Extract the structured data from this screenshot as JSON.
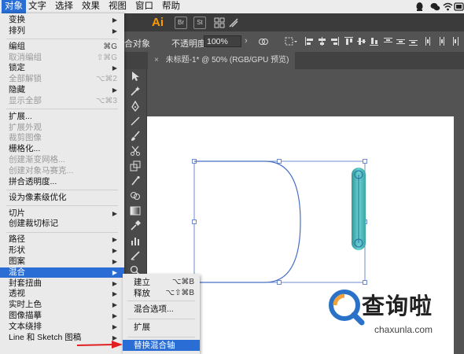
{
  "menubar": {
    "items": [
      "对象",
      "文字",
      "选择",
      "效果",
      "视图",
      "窗口",
      "帮助"
    ],
    "active_index": 0,
    "tray_icons": [
      "qq-icon",
      "wechat-icon",
      "wifi-icon",
      "battery-icon",
      "app-icon"
    ]
  },
  "appbar": {
    "app_label": "Ai"
  },
  "control_bar": {
    "partial_label": "合对象",
    "opacity_label": "不透明度:",
    "opacity_value": "100%"
  },
  "document_tab": {
    "label": "未标题-1* @ 50% (RGB/GPU 预览)"
  },
  "main_menu": {
    "items": [
      {
        "label": "变换",
        "shortcut": "",
        "submenu": true,
        "disabled": false,
        "sep_after": false
      },
      {
        "label": "排列",
        "shortcut": "",
        "submenu": true,
        "disabled": false,
        "sep_after": true
      },
      {
        "label": "编组",
        "shortcut": "⌘G",
        "submenu": false,
        "disabled": false,
        "sep_after": false
      },
      {
        "label": "取消编组",
        "shortcut": "⇧⌘G",
        "submenu": false,
        "disabled": true,
        "sep_after": false
      },
      {
        "label": "锁定",
        "shortcut": "",
        "submenu": true,
        "disabled": false,
        "sep_after": false
      },
      {
        "label": "全部解锁",
        "shortcut": "⌥⌘2",
        "submenu": false,
        "disabled": true,
        "sep_after": false
      },
      {
        "label": "隐藏",
        "shortcut": "",
        "submenu": true,
        "disabled": false,
        "sep_after": false
      },
      {
        "label": "显示全部",
        "shortcut": "⌥⌘3",
        "submenu": false,
        "disabled": true,
        "sep_after": true
      },
      {
        "label": "扩展...",
        "shortcut": "",
        "submenu": false,
        "disabled": false,
        "sep_after": false
      },
      {
        "label": "扩展外观",
        "shortcut": "",
        "submenu": false,
        "disabled": true,
        "sep_after": false
      },
      {
        "label": "裁剪图像",
        "shortcut": "",
        "submenu": false,
        "disabled": true,
        "sep_after": false
      },
      {
        "label": "栅格化...",
        "shortcut": "",
        "submenu": false,
        "disabled": false,
        "sep_after": false
      },
      {
        "label": "创建渐变网格...",
        "shortcut": "",
        "submenu": false,
        "disabled": true,
        "sep_after": false
      },
      {
        "label": "创建对象马赛克...",
        "shortcut": "",
        "submenu": false,
        "disabled": true,
        "sep_after": false
      },
      {
        "label": "拼合透明度...",
        "shortcut": "",
        "submenu": false,
        "disabled": false,
        "sep_after": true
      },
      {
        "label": "设为像素级优化",
        "shortcut": "",
        "submenu": false,
        "disabled": false,
        "sep_after": true
      },
      {
        "label": "切片",
        "shortcut": "",
        "submenu": true,
        "disabled": false,
        "sep_after": false
      },
      {
        "label": "创建裁切标记",
        "shortcut": "",
        "submenu": false,
        "disabled": false,
        "sep_after": true
      },
      {
        "label": "路径",
        "shortcut": "",
        "submenu": true,
        "disabled": false,
        "sep_after": false
      },
      {
        "label": "形状",
        "shortcut": "",
        "submenu": true,
        "disabled": false,
        "sep_after": false
      },
      {
        "label": "图案",
        "shortcut": "",
        "submenu": true,
        "disabled": false,
        "sep_after": false
      },
      {
        "label": "混合",
        "shortcut": "",
        "submenu": true,
        "disabled": false,
        "sep_after": false,
        "highlighted": true
      },
      {
        "label": "封套扭曲",
        "shortcut": "",
        "submenu": true,
        "disabled": false,
        "sep_after": false
      },
      {
        "label": "透视",
        "shortcut": "",
        "submenu": true,
        "disabled": false,
        "sep_after": false
      },
      {
        "label": "实时上色",
        "shortcut": "",
        "submenu": true,
        "disabled": false,
        "sep_after": false
      },
      {
        "label": "图像描摹",
        "shortcut": "",
        "submenu": true,
        "disabled": false,
        "sep_after": false
      },
      {
        "label": "文本绕排",
        "shortcut": "",
        "submenu": true,
        "disabled": false,
        "sep_after": false
      },
      {
        "label": "Line 和 Sketch 图稿",
        "shortcut": "",
        "submenu": true,
        "disabled": false,
        "sep_after": false
      }
    ]
  },
  "submenu": {
    "items": [
      {
        "label": "建立",
        "shortcut": "⌥⌘B"
      },
      {
        "label": "释放",
        "shortcut": "⌥⇧⌘B"
      },
      {
        "label": "混合选项...",
        "shortcut": ""
      },
      {
        "label": "扩展",
        "shortcut": ""
      },
      {
        "label": "替换混合轴",
        "shortcut": "",
        "highlighted": true
      }
    ]
  },
  "annotation": {
    "arrow_color": "#e02020"
  },
  "watermark": {
    "text": "查询啦",
    "url": "chaxunla.com"
  },
  "colors": {
    "menu_highlight": "#2a6ed5",
    "path_stroke": "#4a6fc7",
    "blend_fill": "#4fb8b8"
  }
}
